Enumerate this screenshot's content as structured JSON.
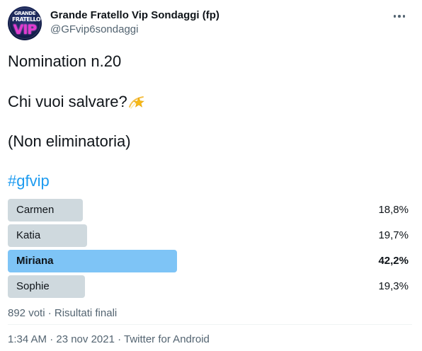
{
  "author": {
    "display_name": "Grande Fratello Vip Sondaggi (fp)",
    "handle": "@GFvip6sondaggi",
    "avatar_text_top": "GRANDE",
    "avatar_text_mid": "FRATELLO",
    "avatar_text_vip": "VIP"
  },
  "tweet": {
    "line1": "Nomination n.20",
    "line2": "Chi vuoi salvare?",
    "line2_emoji": "dizzy-star-emoji",
    "line3": "(Non eliminatoria)",
    "hashtag": "#gfvip"
  },
  "poll": {
    "options": [
      {
        "label": "Carmen",
        "percent_text": "18,8%",
        "percent": 18.8,
        "winner": false
      },
      {
        "label": "Katia",
        "percent_text": "19,7%",
        "percent": 19.7,
        "winner": false
      },
      {
        "label": "Miriana",
        "percent_text": "42,2%",
        "percent": 42.2,
        "winner": true
      },
      {
        "label": "Sophie",
        "percent_text": "19,3%",
        "percent": 19.3,
        "winner": false
      }
    ],
    "summary": "892 voti · Risultati finali",
    "bar_color": "#cfd9de",
    "winner_color": "#7ec4f6"
  },
  "footer": {
    "time_date": "1:34 AM · 23 nov 2021 · ",
    "source": "Twitter for Android"
  },
  "icons": {
    "more": "more-horizontal-icon"
  }
}
